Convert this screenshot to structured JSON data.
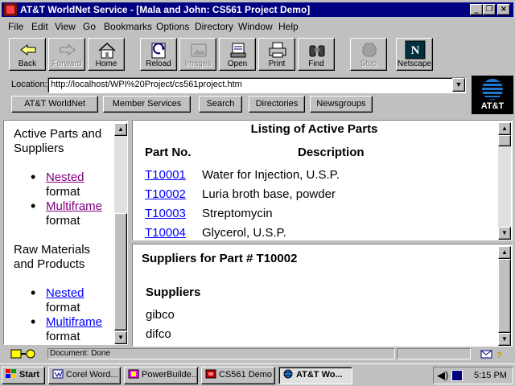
{
  "window": {
    "title": "AT&T WorldNet Service - [Mala and John: CS561 Project Demo]",
    "controls": {
      "minimize": "_",
      "restore": "❐",
      "close": "×"
    }
  },
  "menu": [
    "File",
    "Edit",
    "View",
    "Go",
    "Bookmarks",
    "Options",
    "Directory",
    "Window",
    "Help"
  ],
  "toolbar": {
    "back": "Back",
    "forward": "Forward",
    "home": "Home",
    "reload": "Reload",
    "images": "Images",
    "open": "Open",
    "print": "Print",
    "find": "Find",
    "stop": "Stop",
    "netscape": "Netscape"
  },
  "location": {
    "label": "Location:",
    "url": "http://localhost/WPI%20Project/cs561project.htm"
  },
  "directory_buttons": [
    "AT&T WorldNet",
    "Member Services",
    "Search",
    "Directories",
    "Newsgroups"
  ],
  "logo": {
    "text": "AT&T"
  },
  "left_frame": {
    "section1": {
      "heading": "Active Parts and Suppliers",
      "links": [
        {
          "link": "Nested",
          "suffix": "format",
          "visited": true
        },
        {
          "link": "Multiframe",
          "suffix": "format",
          "visited": true
        }
      ]
    },
    "section2": {
      "heading": "Raw Materials and Products",
      "links": [
        {
          "link": "Nested",
          "suffix": "format",
          "visited": false
        },
        {
          "link": "Multiframe",
          "suffix": "format",
          "visited": false
        }
      ]
    }
  },
  "parts_frame": {
    "title": "Listing of Active Parts",
    "columns": [
      "Part No.",
      "Description"
    ],
    "rows": [
      {
        "part": "T10001",
        "description": "Water for Injection, U.S.P."
      },
      {
        "part": "T10002",
        "description": "Luria broth base, powder"
      },
      {
        "part": "T10003",
        "description": "Streptomycin"
      },
      {
        "part": "T10004",
        "description": "Glycerol, U.S.P."
      }
    ]
  },
  "suppliers_frame": {
    "title": "Suppliers for Part # T10002",
    "heading": "Suppliers",
    "items": [
      "gibco",
      "difco"
    ]
  },
  "status": {
    "text": "Document: Done"
  },
  "taskbar": {
    "start": "Start",
    "tasks": [
      "Corel Word...",
      "PowerBuilde...",
      "CS561 Demo",
      "AT&T Wo..."
    ],
    "clock": "5:15 PM"
  },
  "colors": {
    "titlebar": "#000080",
    "link": "#0000ff",
    "visited": "#800080",
    "face": "#c0c0c0"
  }
}
